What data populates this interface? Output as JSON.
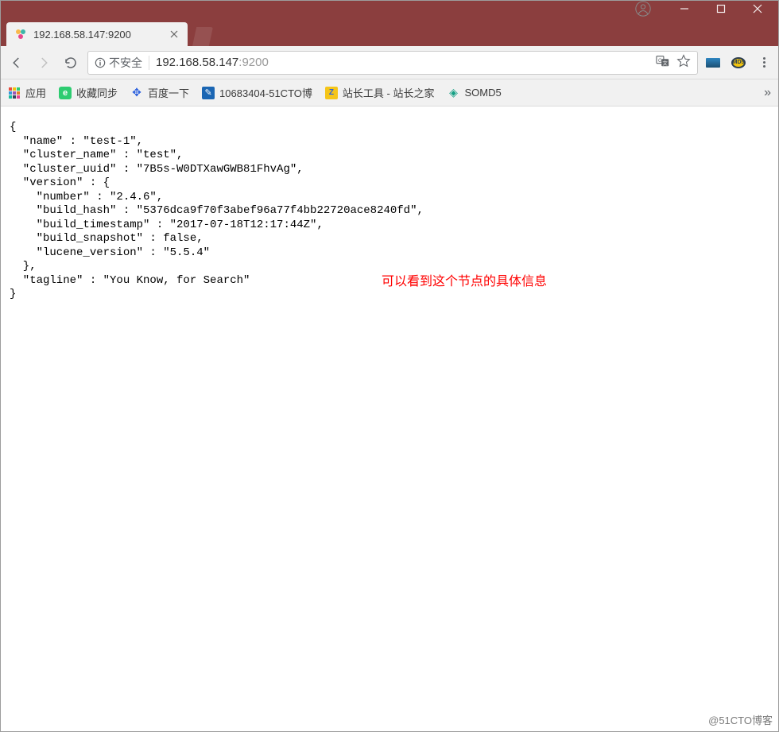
{
  "window": {
    "user_icon": "user-circle-icon",
    "minimize_icon": "minimize-icon",
    "maximize_icon": "maximize-icon",
    "close_icon": "close-icon"
  },
  "tab": {
    "title": "192.168.58.147:9200",
    "favicon": "elasticsearch-favicon",
    "close_icon": "close-icon"
  },
  "toolbar": {
    "back_icon": "arrow-left-icon",
    "forward_icon": "arrow-right-icon",
    "reload_icon": "reload-icon",
    "secure_info_icon": "info-circle-icon",
    "secure_label": "不安全",
    "url_host": "192.168.58.147",
    "url_port": ":9200",
    "translate_icon": "translate-icon",
    "star_icon": "star-outline-icon",
    "ext1_icon": "extension-icon-1",
    "ext2_icon": "extension-icon-2",
    "ext2_label": "MD5",
    "menu_icon": "kebab-menu-icon"
  },
  "bookmarks": {
    "apps_label": "应用",
    "items": [
      {
        "label": "收藏同步",
        "icon": "green-e-icon",
        "icon_bg": "#2ecc71",
        "icon_fg": "#ffffff",
        "glyph": "e"
      },
      {
        "label": "百度一下",
        "icon": "baidu-paw-icon",
        "icon_bg": "#ffffff",
        "icon_fg": "#2b60de",
        "glyph": "⚙"
      },
      {
        "label": "10683404-51CTO博",
        "icon": "blue-feather-icon",
        "icon_bg": "#1b66b3",
        "icon_fg": "#ffffff",
        "glyph": "✎"
      },
      {
        "label": "站长工具 - 站长之家",
        "icon": "yellow-z-icon",
        "icon_bg": "#f5c518",
        "icon_fg": "#2b60de",
        "glyph": "Z"
      },
      {
        "label": "SOMD5",
        "icon": "green-hex-icon",
        "icon_bg": "#ffffff",
        "icon_fg": "#16a085",
        "glyph": "◆"
      }
    ],
    "overflow_icon": "chevron-right-double-icon",
    "overflow_glyph": "»"
  },
  "body": {
    "json_text": "{\n  \"name\" : \"test-1\",\n  \"cluster_name\" : \"test\",\n  \"cluster_uuid\" : \"7B5s-W0DTXawGWB81FhvAg\",\n  \"version\" : {\n    \"number\" : \"2.4.6\",\n    \"build_hash\" : \"5376dca9f70f3abef96a77f4bb22720ace8240fd\",\n    \"build_timestamp\" : \"2017-07-18T12:17:44Z\",\n    \"build_snapshot\" : false,\n    \"lucene_version\" : \"5.5.4\"\n  },\n  \"tagline\" : \"You Know, for Search\"\n}",
    "annotation": "可以看到这个节点的具体信息"
  },
  "watermark": "@51CTO博客"
}
